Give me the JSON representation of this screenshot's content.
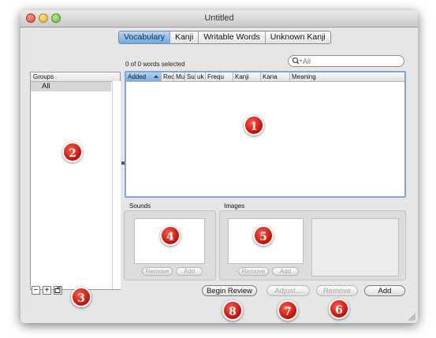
{
  "window": {
    "title": "Untitled"
  },
  "tabs": [
    {
      "label": "Vocabulary",
      "active": true
    },
    {
      "label": "Kanji",
      "active": false
    },
    {
      "label": "Writable Words",
      "active": false
    },
    {
      "label": "Unknown Kanji",
      "active": false
    }
  ],
  "status": {
    "selection_text": "0 of 0 words selected"
  },
  "search": {
    "placeholder": "All",
    "icon": "magnifier-icon"
  },
  "groups": {
    "header": "Groups",
    "items": [
      "All"
    ]
  },
  "word_table": {
    "columns": [
      "Added",
      "Req",
      "Mu",
      "Su",
      "uk",
      "Frequ",
      "Kanji",
      "Kana",
      "Meaning"
    ],
    "sort_column": "Added",
    "rows": []
  },
  "sounds": {
    "label": "Sounds",
    "remove": "Remove",
    "add": "Add"
  },
  "images": {
    "label": "Images",
    "remove": "Remove",
    "add": "Add"
  },
  "group_buttons": {
    "remove": "−",
    "add": "+",
    "smart": "smart-group-icon"
  },
  "footer": {
    "begin_review": "Begin Review",
    "adjust": "Adjust...",
    "remove": "Remove",
    "add": "Add"
  },
  "callouts": [
    "1",
    "2",
    "3",
    "4",
    "5",
    "6",
    "7",
    "8"
  ],
  "colors": {
    "accent": "#6ea9e0",
    "selection": "#d6d6d6",
    "badge": "#d0140c"
  }
}
